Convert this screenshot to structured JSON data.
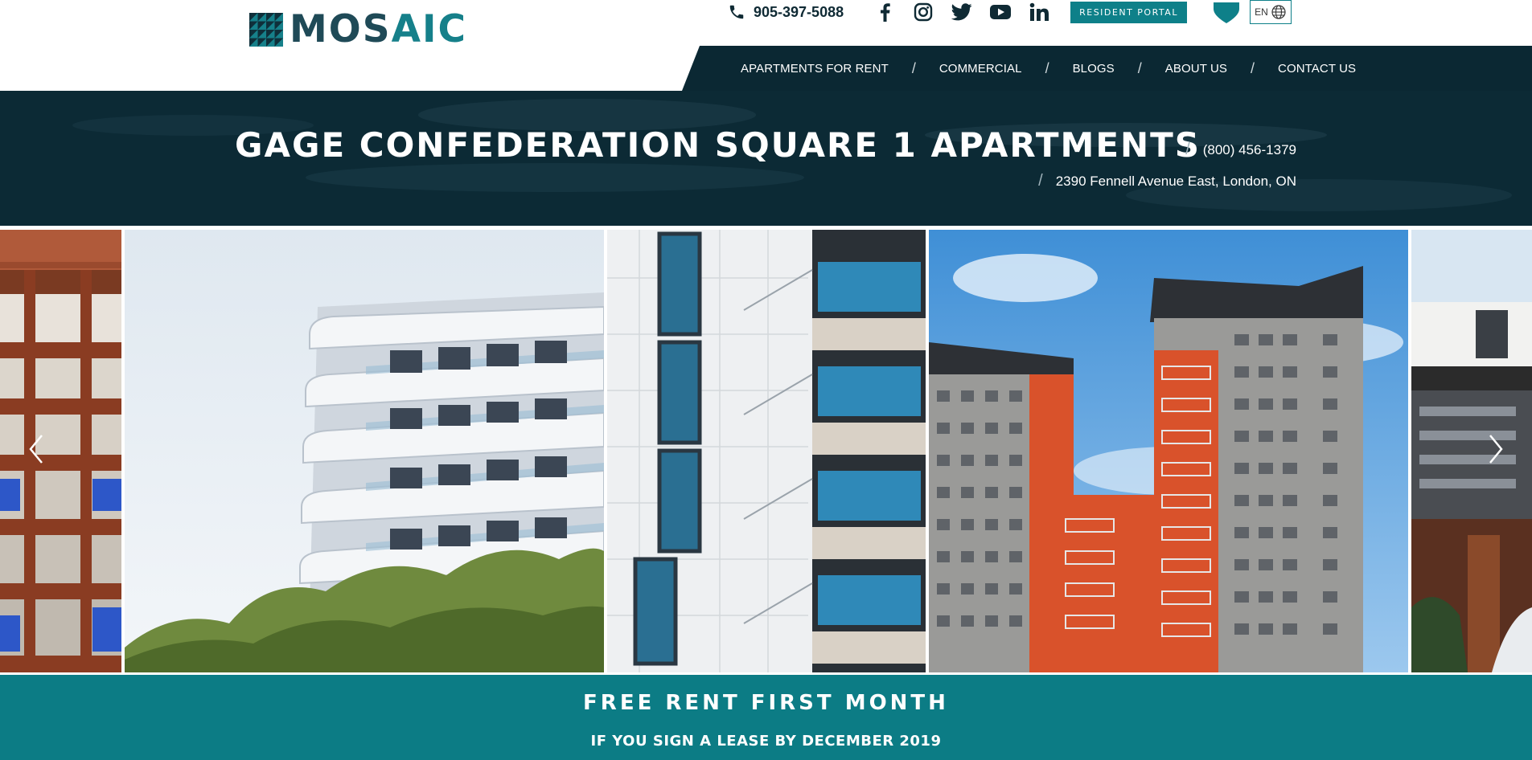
{
  "brand": {
    "name_part1": "MOS",
    "name_part2": "AIC",
    "logo_icon": "mosaic-logo-icon"
  },
  "topbar": {
    "phone": "905-397-5088",
    "phone_icon": "phone-icon",
    "socials": [
      "facebook-icon",
      "instagram-icon",
      "twitter-icon",
      "youtube-icon",
      "linkedin-icon"
    ],
    "resident_portal_label": "RESIDENT PORTAL",
    "favorites_icon": "heart-icon",
    "language_label": "EN",
    "language_icon": "globe-icon"
  },
  "nav": {
    "items": [
      "APARTMENTS FOR RENT",
      "COMMERCIAL",
      "BLOGS",
      "ABOUT US",
      "CONTACT US"
    ],
    "separator": "/"
  },
  "property": {
    "title": "GAGE CONFEDERATION SQUARE 1 APARTMENTS",
    "phone": "(800) 456-1379",
    "address": "2390 Fennell Avenue East, London, ON",
    "separator": "/"
  },
  "gallery": {
    "prev_icon": "chevron-left-icon",
    "next_icon": "chevron-right-icon",
    "slides": [
      "brick-balcony-building",
      "white-curved-balcony-building",
      "white-tile-facade-blue-windows",
      "orange-grey-tower-blocks",
      "modern-dark-wood-house"
    ]
  },
  "promo": {
    "title": "FREE RENT FIRST MONTH",
    "subtitle": "IF YOU SIGN A LEASE BY DECEMBER 2019"
  },
  "colors": {
    "navy": "#0b2833",
    "teal": "#0e8089",
    "promo": "#0c7c85"
  }
}
